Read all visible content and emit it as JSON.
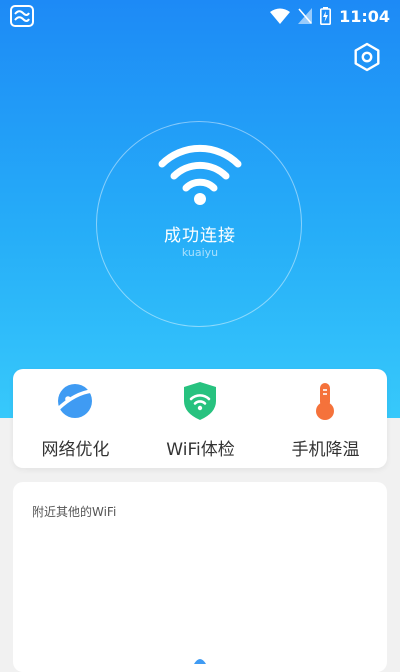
{
  "status_bar": {
    "time": "11:04",
    "icons": [
      "app-notification-icon",
      "wifi-icon",
      "no-signal-icon",
      "battery-charging-icon"
    ]
  },
  "header": {
    "settings_icon": "settings-icon"
  },
  "connection": {
    "status_text": "成功连接",
    "ssid": "kuaiyu",
    "icon": "wifi-icon"
  },
  "features": [
    {
      "label": "网络优化",
      "icon": "planet-icon",
      "color": "#3f9bf3"
    },
    {
      "label": "WiFi体检",
      "icon": "shield-wifi-icon",
      "color": "#27c27f"
    },
    {
      "label": "手机降温",
      "icon": "thermometer-icon",
      "color": "#f5723b"
    }
  ],
  "nearby": {
    "title": "附近其他的WiFi"
  },
  "colors": {
    "hero_top": "#1d8af6",
    "hero_bottom": "#37c9fb",
    "background": "#f1f1f1"
  }
}
